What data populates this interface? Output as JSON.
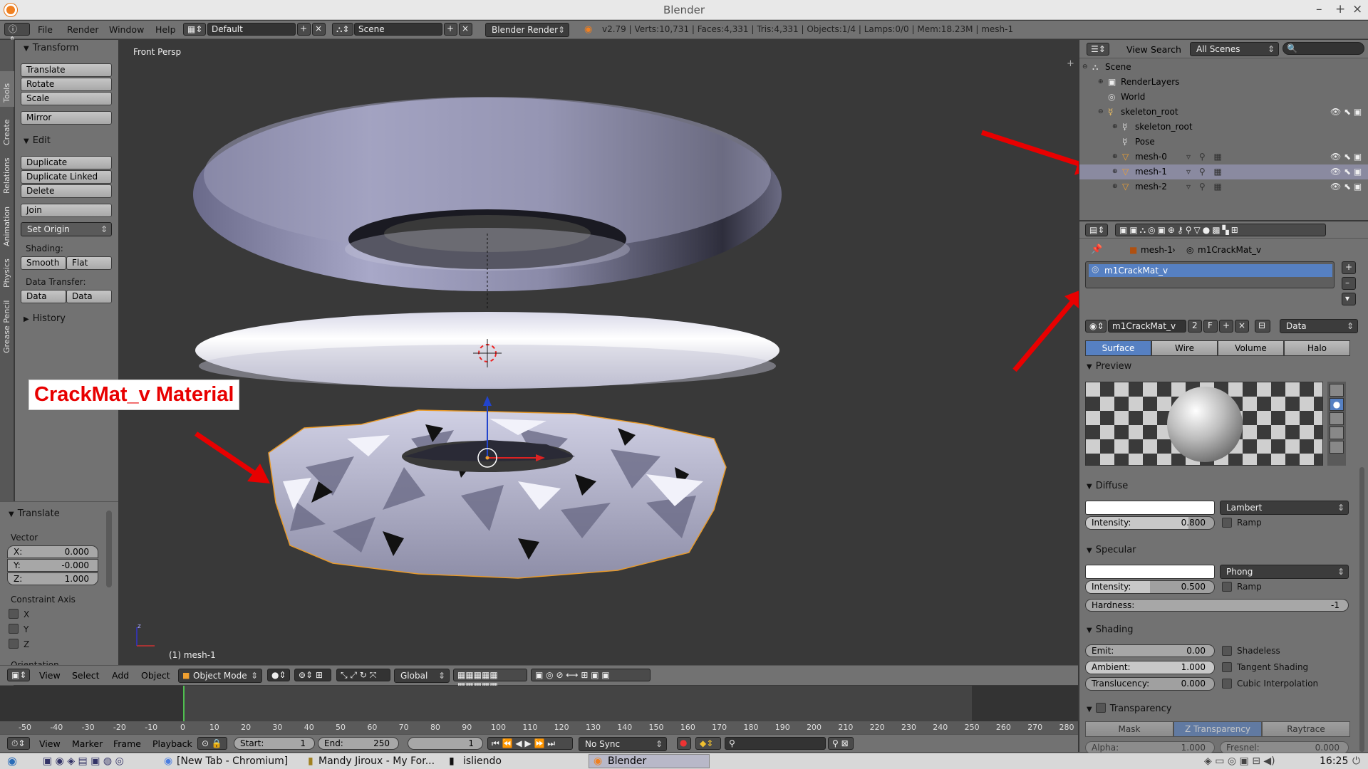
{
  "window": {
    "title": "Blender",
    "minimize": "–",
    "maximize": "+",
    "close": "×"
  },
  "info_header": {
    "menus": [
      "File",
      "Render",
      "Window",
      "Help"
    ],
    "layout": "Default",
    "scene": "Scene",
    "engine": "Blender Render",
    "stats": "v2.79 | Verts:10,731 | Faces:4,331 | Tris:4,331 | Objects:1/4 | Lamps:0/0 | Mem:18.23M | mesh-1"
  },
  "tool_tabs": [
    "Tools",
    "Create",
    "Relations",
    "Animation",
    "Physics",
    "Grease Pencil"
  ],
  "tool_shelf": {
    "transform_header": "Transform",
    "transform_buttons": [
      "Translate",
      "Rotate",
      "Scale",
      "Mirror"
    ],
    "edit_header": "Edit",
    "edit_buttons": [
      "Duplicate",
      "Duplicate Linked",
      "Delete",
      "Join"
    ],
    "set_origin": "Set Origin",
    "shading_label": "Shading:",
    "smooth": "Smooth",
    "flat": "Flat",
    "data_transfer_label": "Data Transfer:",
    "data": "Data",
    "data_layout": "Data Layo",
    "history": "History"
  },
  "redo_panel": {
    "header": "Translate",
    "vector_label": "Vector",
    "x_label": "X:",
    "x": "0.000",
    "y_label": "Y:",
    "y": "-0.000",
    "z_label": "Z:",
    "z": "1.000",
    "constraint_label": "Constraint Axis",
    "axes": [
      "X",
      "Y",
      "Z"
    ],
    "orientation_label": "Orientation"
  },
  "viewport": {
    "view_name": "Front Persp",
    "object_label": "(1) mesh-1",
    "annotation": "CrackMat_v Material"
  },
  "view3d_header": {
    "menus": [
      "View",
      "Select",
      "Add",
      "Object"
    ],
    "mode": "Object Mode",
    "orientation": "Global"
  },
  "timeline": {
    "ticks": [
      "-50",
      "-40",
      "-30",
      "-20",
      "-10",
      "0",
      "10",
      "20",
      "30",
      "40",
      "50",
      "60",
      "70",
      "80",
      "90",
      "100",
      "110",
      "120",
      "130",
      "140",
      "150",
      "160",
      "170",
      "180",
      "190",
      "200",
      "210",
      "220",
      "230",
      "240",
      "250",
      "260",
      "270",
      "280"
    ],
    "menus": [
      "View",
      "Marker",
      "Frame",
      "Playback"
    ],
    "start_label": "Start:",
    "start": "1",
    "end_label": "End:",
    "end": "250",
    "current": "1",
    "sync": "No Sync"
  },
  "outliner": {
    "menus": [
      "View",
      "Search"
    ],
    "scope": "All Scenes",
    "rows": [
      {
        "label": "Scene"
      },
      {
        "label": "RenderLayers"
      },
      {
        "label": "World"
      },
      {
        "label": "skeleton_root"
      },
      {
        "label": "skeleton_root"
      },
      {
        "label": "Pose"
      },
      {
        "label": "mesh-0"
      },
      {
        "label": "mesh-1"
      },
      {
        "label": "mesh-2"
      }
    ]
  },
  "properties": {
    "breadcrumb_object": "mesh-1",
    "breadcrumb_material": "m1CrackMat_v",
    "slot": "m1CrackMat_v",
    "material_name": "m1CrackMat_v",
    "users": "2",
    "fake_user": "F",
    "link": "Data",
    "tabs": [
      "Surface",
      "Wire",
      "Volume",
      "Halo"
    ],
    "preview_header": "Preview",
    "diffuse_header": "Diffuse",
    "diffuse_shader": "Lambert",
    "diffuse_intensity_label": "Intensity:",
    "diffuse_intensity": "0.800",
    "ramp": "Ramp",
    "specular_header": "Specular",
    "specular_shader": "Phong",
    "specular_intensity_label": "Intensity:",
    "specular_intensity": "0.500",
    "hardness_label": "Hardness:",
    "hardness": "-1",
    "shading_header": "Shading",
    "emit_label": "Emit:",
    "emit": "0.00",
    "ambient_label": "Ambient:",
    "ambient": "1.000",
    "translucency_label": "Translucency:",
    "translucency": "0.000",
    "shadeless": "Shadeless",
    "tangent_shading": "Tangent Shading",
    "cubic_interpolation": "Cubic Interpolation",
    "transparency_header": "Transparency",
    "transparency_modes": [
      "Mask",
      "Z Transparency",
      "Raytrace"
    ],
    "alpha_label": "Alpha:",
    "alpha": "1.000",
    "fresnel_label": "Fresnel:",
    "fresnel": "0.000"
  },
  "taskbar": {
    "tasks": [
      "[New Tab - Chromium]",
      "Mandy Jiroux - My For...",
      "isliendo",
      "Blender"
    ],
    "clock": "16:25"
  }
}
